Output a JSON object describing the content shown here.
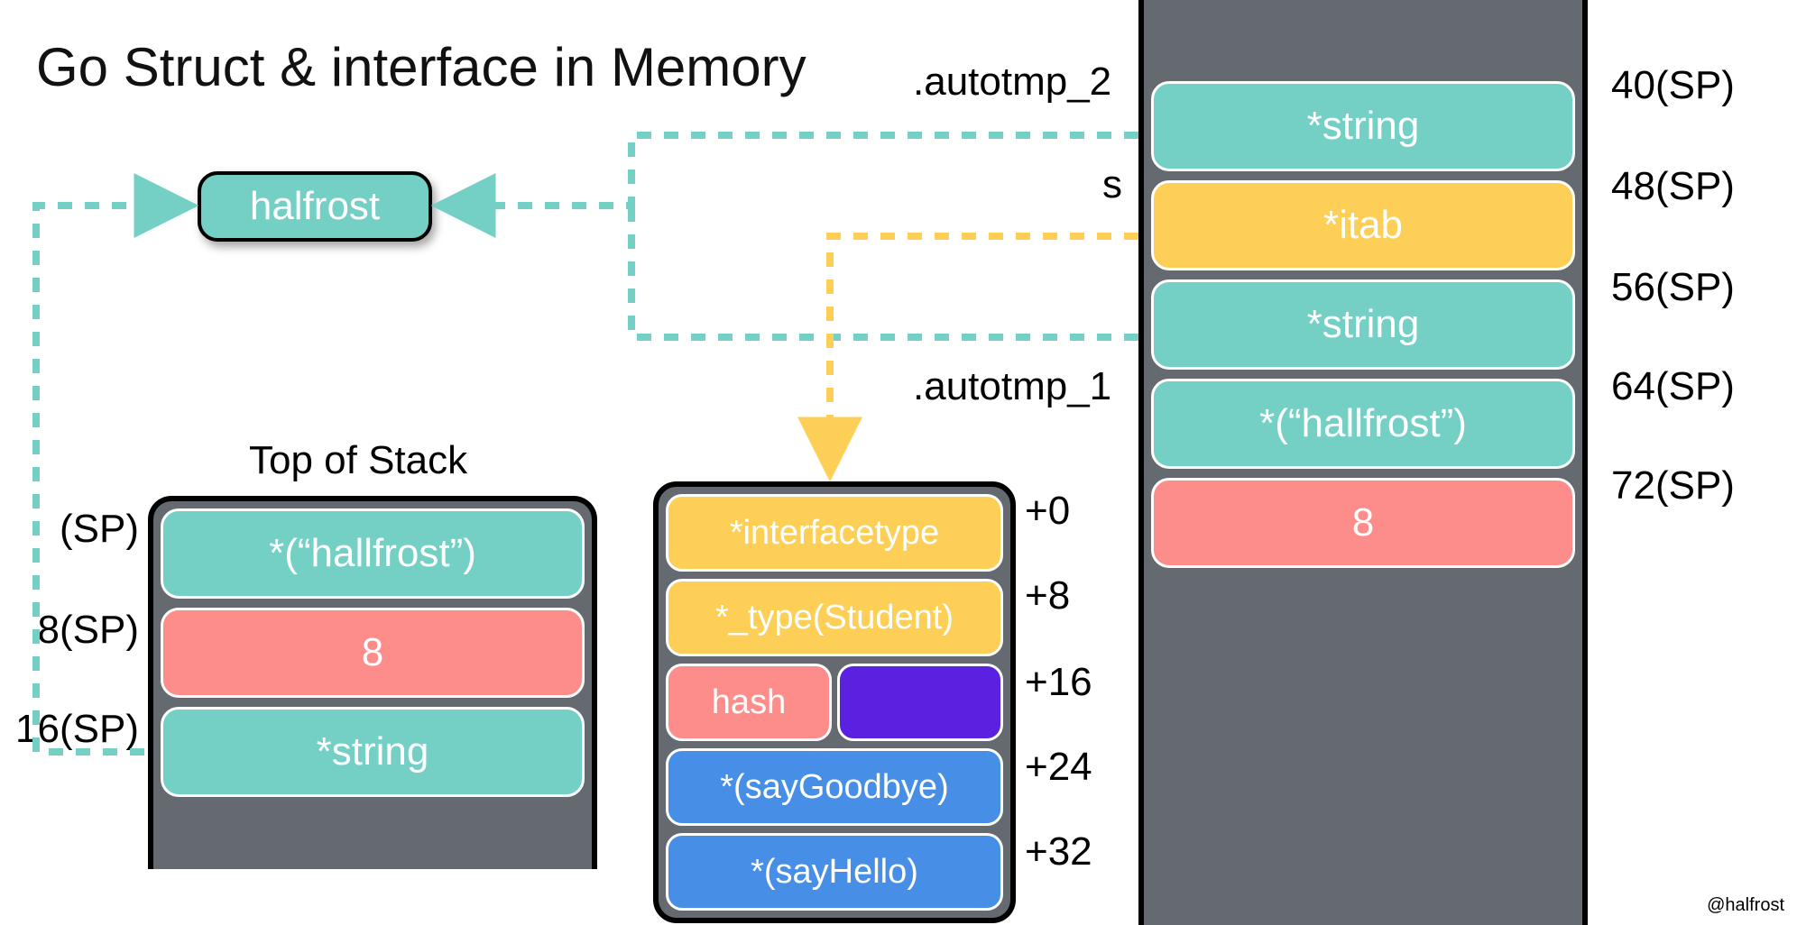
{
  "title": "Go Struct & interface in Memory",
  "watermark": "@halfrost",
  "halfrost": "halfrost",
  "left_stack": {
    "header": "Top of Stack",
    "labels": {
      "l0": "(SP)",
      "l1": "8(SP)",
      "l2": "16(SP)"
    },
    "cells": {
      "c0": "*(“hallfrost”)",
      "c1": "8",
      "c2": "*string"
    }
  },
  "itab": {
    "offsets": {
      "o0": "+0",
      "o1": "+8",
      "o2": "+16",
      "o3": "+24",
      "o4": "+32"
    },
    "rows": {
      "r0": "*interfacetype",
      "r1": "*_type(Student)",
      "r2a": "hash",
      "r2b": "",
      "r3": "*(sayGoodbye)",
      "r4": "*(sayHello)"
    }
  },
  "right_stack": {
    "labels_left": {
      "a": ".autotmp_2",
      "b": "s",
      "c": ".autotmp_1"
    },
    "labels_right": {
      "r0": "40(SP)",
      "r1": "48(SP)",
      "r2": "56(SP)",
      "r3": "64(SP)",
      "r4": "72(SP)"
    },
    "cells": {
      "c0": "*string",
      "c1": "*itab",
      "c2": "*string",
      "c3": "*(“hallfrost”)",
      "c4": "8"
    }
  },
  "colors": {
    "teal": "#74cfc4",
    "salmon": "#fc8d8a",
    "yellow": "#fecf56",
    "blue": "#468ee6",
    "purple": "#5b21e0",
    "grey": "#646a70"
  }
}
